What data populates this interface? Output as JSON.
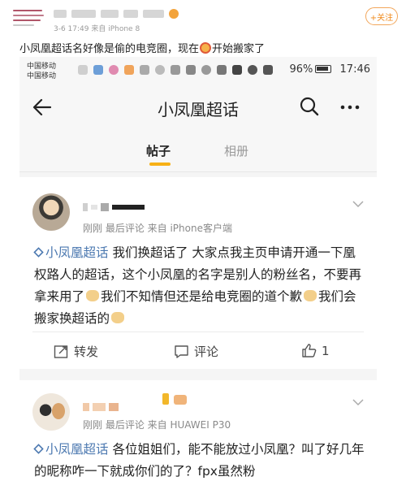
{
  "post": {
    "meta": "3-6 17:49  来自 iPhone 8",
    "follow_label": "+关注",
    "text_before": "小凤凰超话名好像是偷的电竞圈，现在",
    "text_after": "开始搬家了"
  },
  "screenshot": {
    "statusbar": {
      "carrier_1": "中国移动",
      "carrier_2": "中国移动",
      "signal": "²⁶ᴵˡˡ",
      "battery": "96%",
      "time": "17:46"
    },
    "nav": {
      "title": "小凤凰超话"
    },
    "tabs": [
      {
        "label": "帖子",
        "active": true
      },
      {
        "label": "相册",
        "active": false
      }
    ],
    "cards": [
      {
        "meta": "刚刚  最后评论  来自 iPhone客户端",
        "topic": "小凤凰超话",
        "text_1": " 我们换超话了 大家点我主页申请开通一下凰权路人的超话，这个小凤凰的名字是别人的粉丝名，不要再拿来用了",
        "text_2": "我们不知情但还是给电竞圈的道个歉",
        "text_3": "我们会搬家换超话的",
        "actions": {
          "repost": "转发",
          "comment": "评论",
          "like_count": "1"
        }
      },
      {
        "meta": "刚刚  最后评论  来自 HUAWEI P30",
        "topic": "小凤凰超话",
        "text": " 各位姐姐们，能不能放过小凤凰？叫了好几年的昵称咋一下就成你们的了？fpx虽然粉"
      }
    ]
  },
  "colors": {
    "accent": "#f7b015",
    "topic": "#4b78b0",
    "follow": "#f08a1c"
  }
}
